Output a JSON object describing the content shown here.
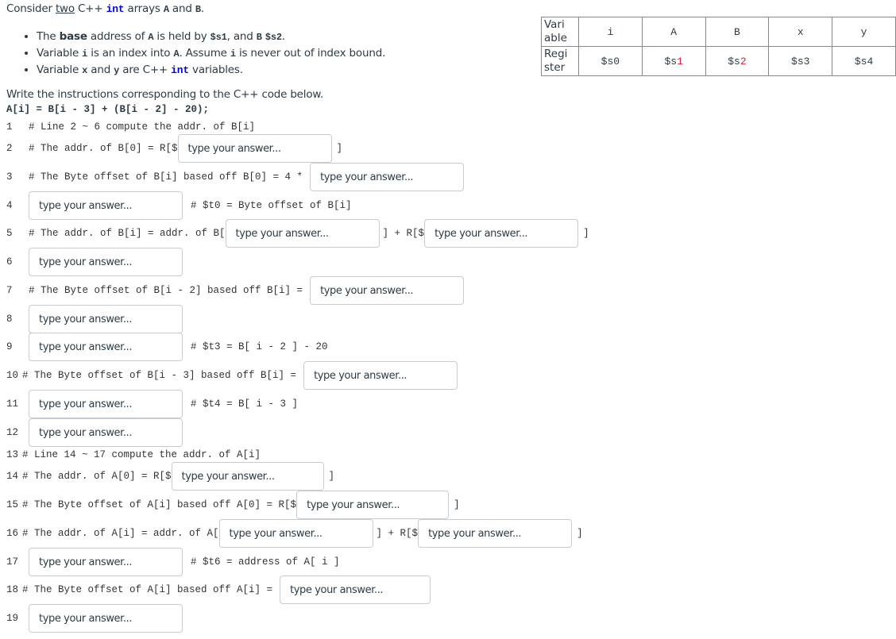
{
  "intro": {
    "prefix": "Consider ",
    "underlined": "two",
    "mid": " C++ ",
    "kw": "int",
    "mid2": " arrays ",
    "a": "A",
    "and": " and ",
    "b": "B",
    "end": "."
  },
  "bullets": [
    {
      "p1": "The ",
      "bold": "base",
      "p2": " address of ",
      "c1": "A",
      "p3": " is held by ",
      "c2": "$s1",
      "p4": ", and ",
      "c3": "B",
      "p5": " ",
      "c4": "$s2",
      "p6": "."
    },
    {
      "p1": "Variable ",
      "c1": "i",
      "p2": " is an index into ",
      "c2": "A",
      "p3": ". Assume ",
      "c3": "i",
      "p4": " is never out of index bound."
    },
    {
      "p1": "Variable ",
      "c1": "x",
      "p2": " and ",
      "c2": "y",
      "p3": " are C++ ",
      "kw": "int",
      "p4": " variables."
    }
  ],
  "register_table": {
    "row1_header": "Variable",
    "row2_header": "Register",
    "variables": [
      "i",
      "A",
      "B",
      "x",
      "y"
    ],
    "registers": [
      {
        "prefix": "$s",
        "num": "0",
        "highlight": false
      },
      {
        "prefix": "$s",
        "num": "1",
        "highlight": true
      },
      {
        "prefix": "$s",
        "num": "2",
        "highlight": true
      },
      {
        "prefix": "$s",
        "num": "3",
        "highlight": false
      },
      {
        "prefix": "$s",
        "num": "4",
        "highlight": false
      }
    ],
    "highlight_color": "#e0203a"
  },
  "instructions": "Write the instructions corresponding to the C++ code below.",
  "cpp_code": "A[i] = B[i - 3] + (B[i - 2] - 20);",
  "placeholder": "type your answer...",
  "lines": {
    "l1": {
      "num": "1",
      "text": "# Line 2 ~ 6 compute the addr. of B[i]"
    },
    "l2": {
      "num": "2",
      "pre": "# The addr. of B[0] = R[$",
      "post": "]"
    },
    "l3": {
      "num": "3",
      "pre": "# The Byte offset of B[i] based off B[0] = 4 *"
    },
    "l4": {
      "num": "4",
      "post": "# $t0 = Byte offset of B[i]"
    },
    "l5": {
      "num": "5",
      "pre": "# The addr. of B[i] = addr. of B[",
      "mid": "] + R[$",
      "post": "]"
    },
    "l6": {
      "num": "6"
    },
    "l7": {
      "num": "7",
      "pre": "# The Byte offset of B[i - 2] based off B[i] ="
    },
    "l8": {
      "num": "8"
    },
    "l9": {
      "num": "9",
      "post": "# $t3 = B[ i - 2 ] - 20"
    },
    "l10": {
      "num": "10",
      "pre": "# The Byte offset of B[i - 3] based off B[i] ="
    },
    "l11": {
      "num": "11",
      "post": "# $t4 = B[ i - 3 ]"
    },
    "l12": {
      "num": "12"
    },
    "l13": {
      "num": "13",
      "text": "# Line 14 ~ 17 compute the addr. of A[i]"
    },
    "l14": {
      "num": "14",
      "pre": "# The addr. of A[0] = R[$",
      "post": "]"
    },
    "l15": {
      "num": "15",
      "pre": "# The Byte offset of A[i] based off A[0] = R[$",
      "post": "]"
    },
    "l16": {
      "num": "16",
      "pre": "# The addr. of A[i] = addr. of A[",
      "mid": "] + R[$",
      "post": "]"
    },
    "l17": {
      "num": "17",
      "post": "# $t6 = address of A[ i ]"
    },
    "l18": {
      "num": "18",
      "pre": "# The Byte offset of A[i] based off A[i] ="
    },
    "l19": {
      "num": "19"
    }
  }
}
